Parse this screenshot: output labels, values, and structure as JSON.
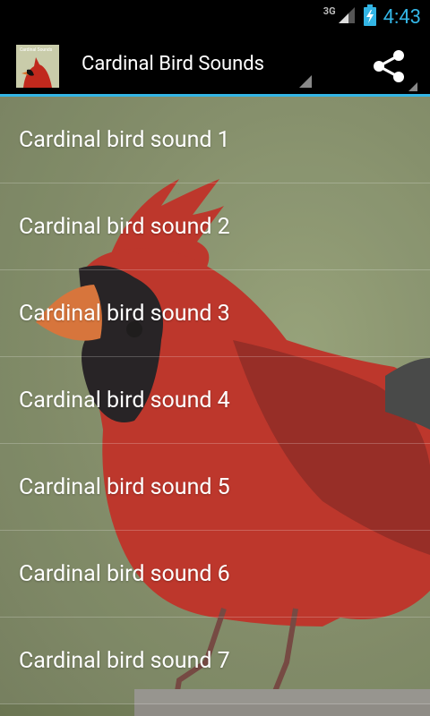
{
  "status_bar": {
    "network": "3G",
    "time": "4:43"
  },
  "action_bar": {
    "title": "Cardinal Bird Sounds",
    "app_icon_text": "Cardinal Sounds",
    "share_icon": "share-icon"
  },
  "list": {
    "items": [
      {
        "label": "Cardinal bird sound 1"
      },
      {
        "label": "Cardinal bird sound 2"
      },
      {
        "label": "Cardinal bird sound 3"
      },
      {
        "label": "Cardinal bird sound 4"
      },
      {
        "label": "Cardinal bird sound 5"
      },
      {
        "label": "Cardinal bird sound 6"
      },
      {
        "label": "Cardinal bird sound 7"
      }
    ]
  },
  "colors": {
    "accent": "#33b5e5",
    "cardinal_red": "#c22a1c"
  }
}
